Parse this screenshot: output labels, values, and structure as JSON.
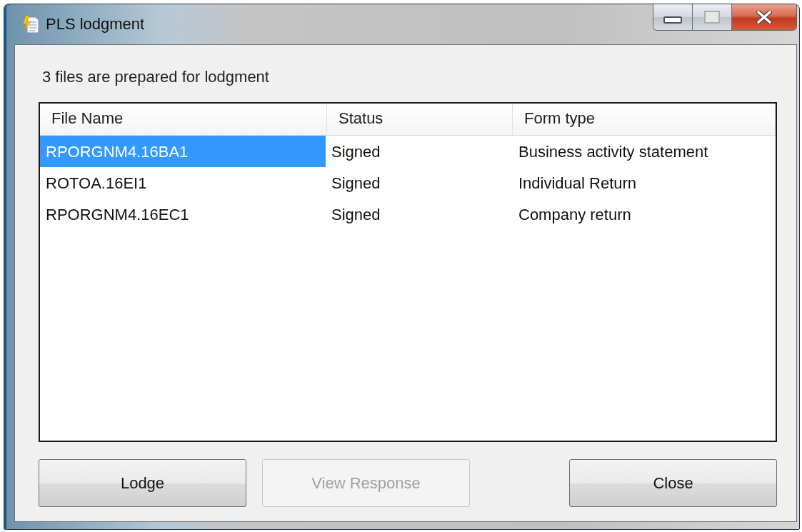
{
  "window": {
    "title": "PLS lodgment"
  },
  "message": "3 files are prepared for lodgment",
  "table": {
    "columns": [
      "File Name",
      "Status",
      "Form type"
    ],
    "rows": [
      {
        "cells": [
          "RPORGNM4.16BA1",
          "Signed",
          "Business activity statement"
        ],
        "selected": true
      },
      {
        "cells": [
          "ROTOA.16EI1",
          "Signed",
          "Individual Return"
        ],
        "selected": false
      },
      {
        "cells": [
          "RPORGNM4.16EC1",
          "Signed",
          "Company return"
        ],
        "selected": false
      }
    ]
  },
  "buttons": [
    {
      "label": "Lodge",
      "disabled": false
    },
    {
      "label": "View Response",
      "disabled": true
    },
    {
      "label": "Close",
      "disabled": false
    }
  ]
}
